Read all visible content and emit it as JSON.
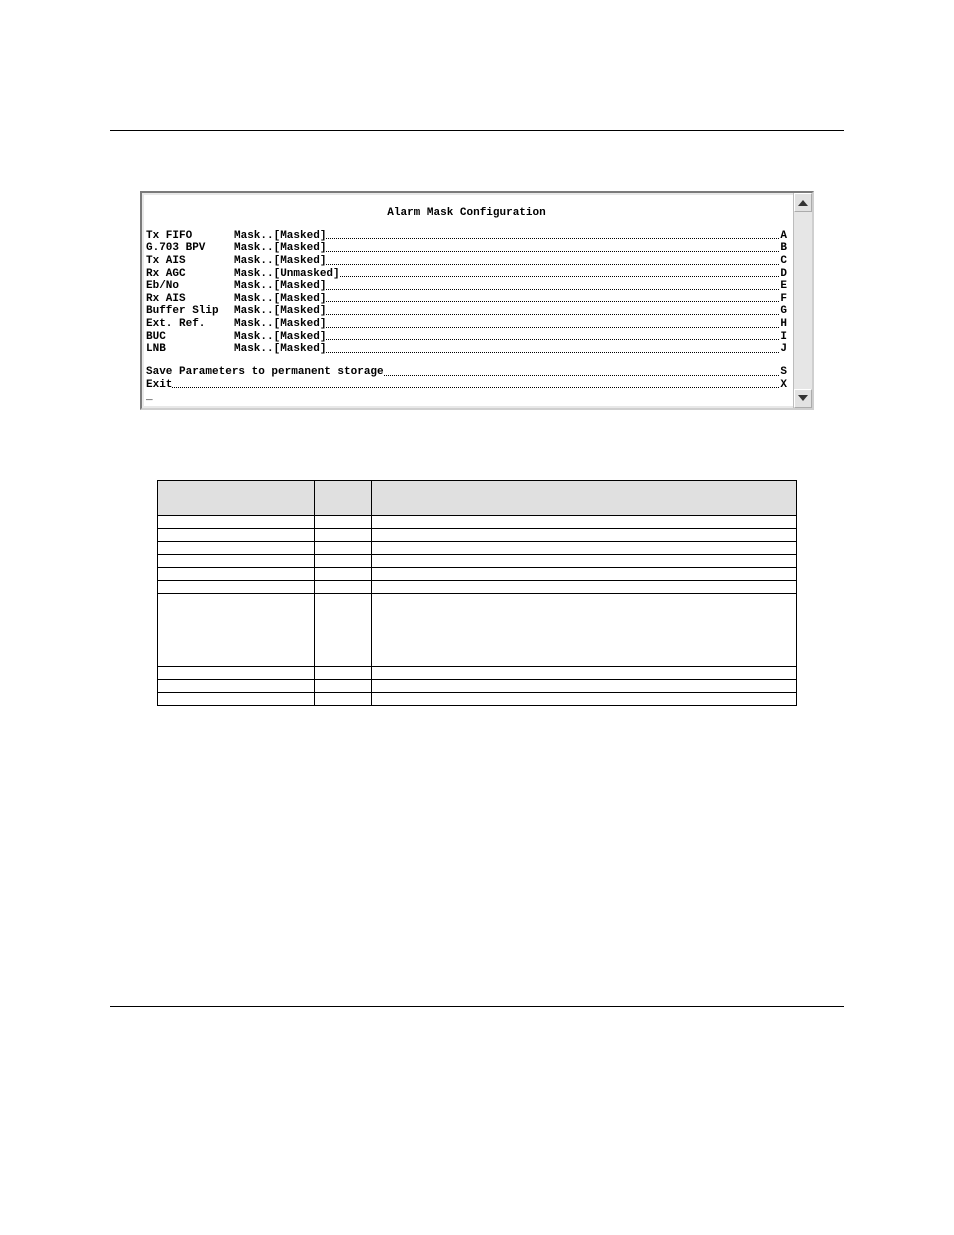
{
  "terminal": {
    "title": "Alarm Mask Configuration",
    "lines": [
      {
        "label": "Tx FIFO",
        "mask": "Mask..[Masked]",
        "key": "A"
      },
      {
        "label": "G.703 BPV",
        "mask": "Mask..[Masked]",
        "key": "B"
      },
      {
        "label": "Tx AIS",
        "mask": "Mask..[Masked]",
        "key": "C"
      },
      {
        "label": "Rx AGC",
        "mask": "Mask..[Unmasked]",
        "key": "D"
      },
      {
        "label": "Eb/No",
        "mask": "Mask..[Masked]",
        "key": "E"
      },
      {
        "label": "Rx AIS",
        "mask": "Mask..[Masked]",
        "key": "F"
      },
      {
        "label": "Buffer Slip",
        "mask": "Mask..[Masked]",
        "key": "G"
      },
      {
        "label": "Ext. Ref.",
        "mask": "Mask..[Masked]",
        "key": "H"
      },
      {
        "label": "BUC",
        "mask": "Mask..[Masked]",
        "key": "I"
      },
      {
        "label": "LNB",
        "mask": "Mask..[Masked]",
        "key": "J"
      }
    ],
    "footer": [
      {
        "text": "Save Parameters to permanent storage",
        "key": "S"
      },
      {
        "text": "Exit",
        "key": "X"
      }
    ]
  },
  "table": {
    "headers": [
      "",
      "",
      ""
    ],
    "rows": [
      {
        "sel": "",
        "opt": "",
        "desc": ""
      },
      {
        "sel": "",
        "opt": "",
        "desc": ""
      },
      {
        "sel": "",
        "opt": "",
        "desc": ""
      },
      {
        "sel": "",
        "opt": "",
        "desc": ""
      },
      {
        "sel": "",
        "opt": "",
        "desc": ""
      },
      {
        "sel": "",
        "opt": "",
        "desc": ""
      },
      {
        "sel": "",
        "opt": "",
        "desc": "",
        "tall": true
      },
      {
        "sel": "",
        "opt": "",
        "desc": ""
      },
      {
        "sel": "",
        "opt": "",
        "desc": ""
      },
      {
        "sel": "",
        "opt": "",
        "desc": ""
      }
    ]
  }
}
